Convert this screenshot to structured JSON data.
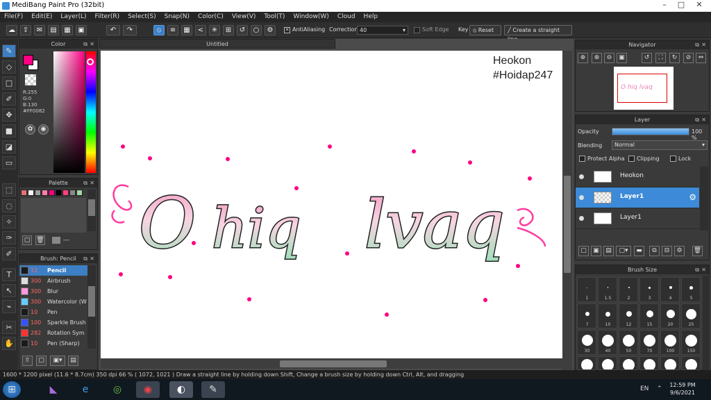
{
  "window": {
    "title": "MediBang Paint Pro (32bit)"
  },
  "menu": [
    "File(F)",
    "Edit(E)",
    "Layer(L)",
    "Filter(R)",
    "Select(S)",
    "Snap(N)",
    "Color(C)",
    "View(V)",
    "Tool(T)",
    "Window(W)",
    "Cloud",
    "Help"
  ],
  "toolbar": {
    "antialiasing_label": "AntiAliasing",
    "correction_label": "Correction",
    "correction_value": "40",
    "soft_edge_label": "Soft Edge",
    "key_label": "Key",
    "reset_label": "Reset",
    "straight_line_label": "Create a straight line"
  },
  "color_panel": {
    "title": "Color",
    "r": "R:255",
    "g": "G:0",
    "b": "B:130",
    "hex": "#FF0082",
    "primary_color": "#FF0082"
  },
  "palette_panel": {
    "title": "Palette",
    "footer": "---",
    "swatches": [
      "#e57373",
      "#f5f5f5",
      "#9e9e9e",
      "#ff80ab",
      "#ff0082",
      "#000000",
      "#ff4081",
      "#888888",
      "#a5d6a7"
    ]
  },
  "brush_panel": {
    "title": "Brush: Pencil",
    "items": [
      {
        "size": "12",
        "name": "Pencil",
        "color": "#1a1a1a",
        "selected": true
      },
      {
        "size": "300",
        "name": "Airbrush",
        "color": "#dddddd"
      },
      {
        "size": "300",
        "name": "Blur",
        "color": "#ff99dd"
      },
      {
        "size": "300",
        "name": "Watercolor (W",
        "color": "#66ccff"
      },
      {
        "size": "10",
        "name": "Pen",
        "color": "#1a1a1a"
      },
      {
        "size": "100",
        "name": "Sparkle Brush",
        "color": "#3355ff"
      },
      {
        "size": "282",
        "name": "Rotation Sym",
        "color": "#ff3333"
      },
      {
        "size": "10",
        "name": "Pen (Sharp)",
        "color": "#1a1a1a"
      }
    ]
  },
  "document": {
    "tab_title": "Untitled",
    "watermark_line1": "Heokon",
    "watermark_line2": "#Hoidap247",
    "artwork_text": "O hiq lvaq"
  },
  "navigator": {
    "title": "Navigator"
  },
  "layer_panel": {
    "title": "Layer",
    "opacity_label": "Opacity",
    "opacity_value": "100 %",
    "opacity_fraction": 1.0,
    "blending_label": "Blending",
    "blending_value": "Normal",
    "protect_alpha": "Protect Alpha",
    "clipping": "Clipping",
    "lock": "Lock",
    "layers": [
      {
        "name": "Heokon",
        "selected": false
      },
      {
        "name": "Layer1",
        "selected": true
      },
      {
        "name": "Layer1",
        "selected": false
      }
    ]
  },
  "brush_size_panel": {
    "title": "Brush Size",
    "sizes": [
      "1",
      "1.5",
      "2",
      "3",
      "4",
      "5",
      "7",
      "10",
      "12",
      "15",
      "20",
      "25",
      "30",
      "40",
      "50",
      "70",
      "100",
      "150"
    ]
  },
  "status": {
    "text": "1600 * 1200 pixel  (11.6 * 8.7cm)  350 dpi  66 %  ( 1072, 1021 )  Draw a straight line by holding down Shift, Change a brush size by holding down Ctrl, Alt, and dragging"
  },
  "taskbar": {
    "lang": "EN",
    "time": "12:59 PM",
    "date": "9/6/2021"
  },
  "colors": {
    "accent": "#3c7fc4",
    "pink": "#ff0082"
  }
}
